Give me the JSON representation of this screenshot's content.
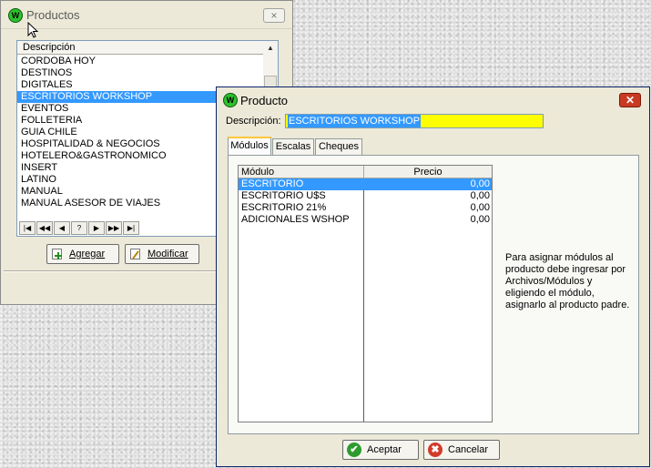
{
  "productos": {
    "title": "Productos",
    "app_icon_letter": "W",
    "close_glyph": "×",
    "column_header": "Descripción",
    "items": [
      {
        "label": "CORDOBA HOY",
        "selected": false
      },
      {
        "label": "DESTINOS",
        "selected": false
      },
      {
        "label": "DIGITALES",
        "selected": false
      },
      {
        "label": "ESCRITORIOS WORKSHOP",
        "selected": true
      },
      {
        "label": "EVENTOS",
        "selected": false
      },
      {
        "label": "FOLLETERIA",
        "selected": false
      },
      {
        "label": "GUIA CHILE",
        "selected": false
      },
      {
        "label": "HOSPITALIDAD & NEGOCIOS",
        "selected": false
      },
      {
        "label": "HOTELERO&GASTRONOMICO",
        "selected": false
      },
      {
        "label": "INSERT",
        "selected": false
      },
      {
        "label": "LATINO",
        "selected": false
      },
      {
        "label": "MANUAL",
        "selected": false
      },
      {
        "label": "MANUAL ASESOR DE VIAJES",
        "selected": false
      }
    ],
    "nav": {
      "first": "|◀",
      "prev_page": "◀◀",
      "prev": "◀",
      "search": "?",
      "next": "▶",
      "next_page": "▶▶",
      "last": "▶|"
    },
    "buttons": {
      "add": "Agregar",
      "edit": "Modificar"
    }
  },
  "producto": {
    "title": "Producto",
    "app_icon_letter": "W",
    "close_glyph": "✕",
    "description_label": "Descripción:",
    "description_value": "ESCRITORIOS WORKSHOP",
    "tabs": [
      {
        "label": "Módulos",
        "active": true
      },
      {
        "label": "Escalas",
        "active": false
      },
      {
        "label": "Cheques",
        "active": false
      }
    ],
    "grid": {
      "col_module": "Módulo",
      "col_price": "Precio",
      "rows": [
        {
          "module": "ESCRITORIO",
          "price": "0,00",
          "selected": true
        },
        {
          "module": "ESCRITORIO U$S",
          "price": "0,00",
          "selected": false
        },
        {
          "module": "ESCRITORIO 21%",
          "price": "0,00",
          "selected": false
        },
        {
          "module": "ADICIONALES WSHOP",
          "price": "0,00",
          "selected": false
        }
      ]
    },
    "hint": "Para asignar módulos al producto debe ingresar por Archivos/Módulos y eligiendo el módulo, asignarlo al producto padre.",
    "buttons": {
      "accept": "Aceptar",
      "accept_icon": "✔",
      "cancel": "Cancelar",
      "cancel_icon": "✖"
    }
  },
  "colors": {
    "selection": "#3399ff",
    "description_highlight": "#ffff00",
    "accept_icon": "#2e9b2e",
    "cancel_icon": "#d23a2a",
    "close_button": "#c83a22"
  }
}
